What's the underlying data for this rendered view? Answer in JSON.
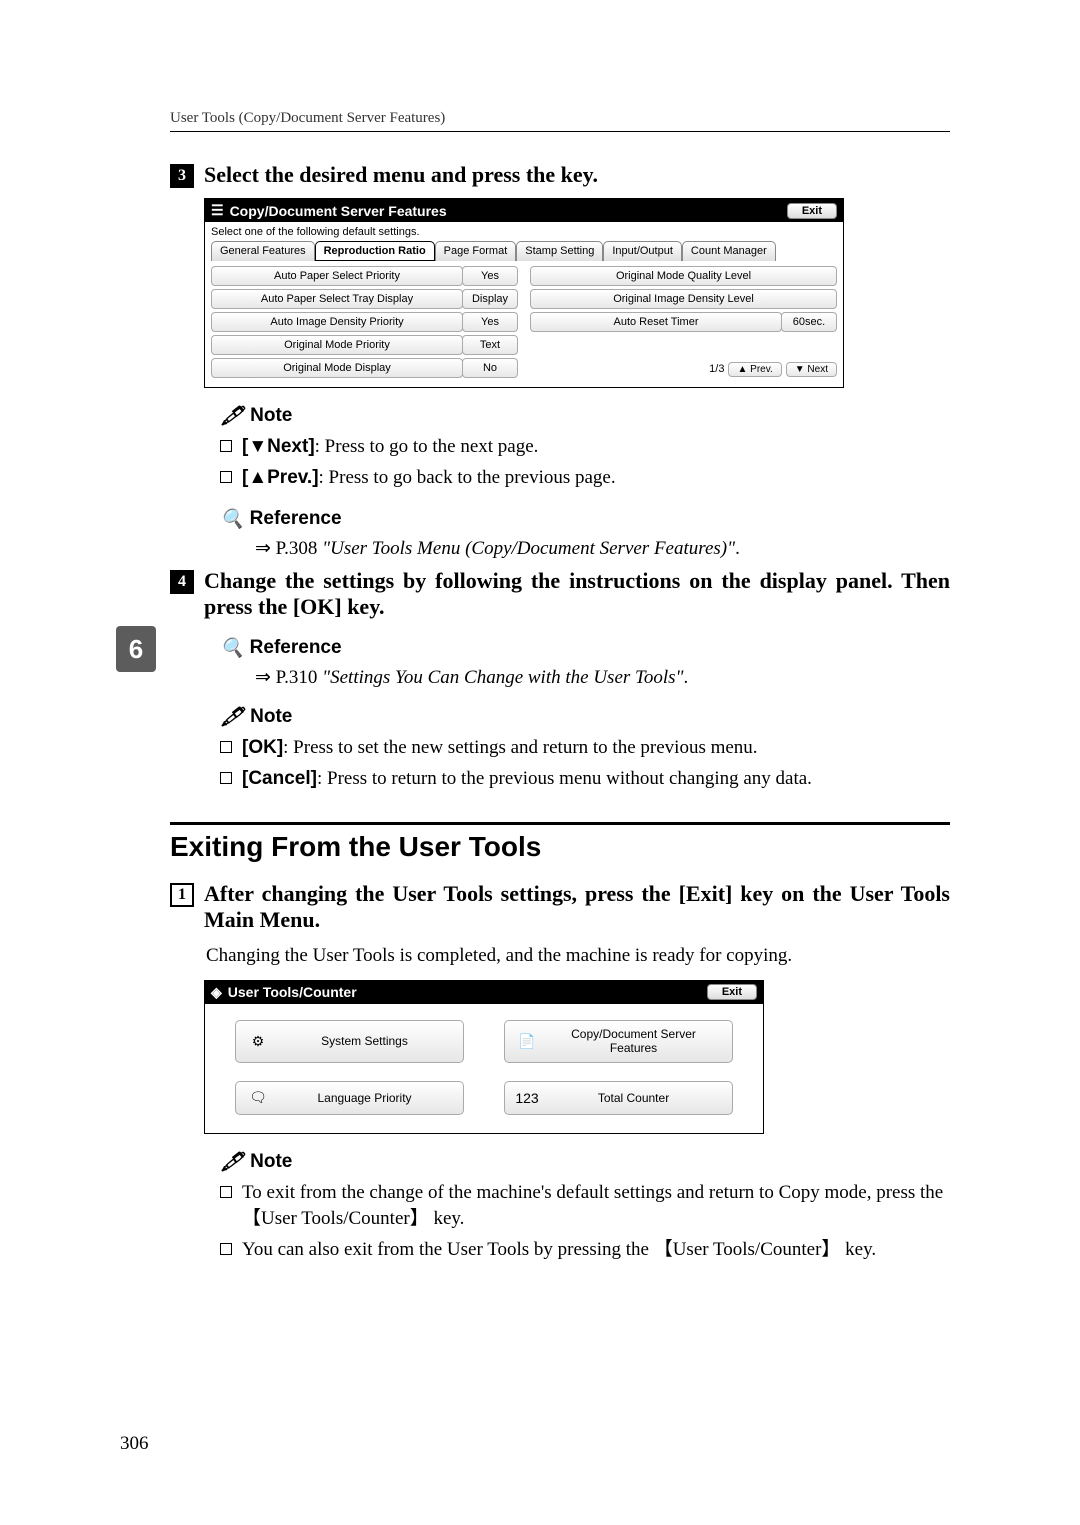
{
  "header": "User Tools (Copy/Document Server Features)",
  "sideTab": "6",
  "pageNumber": "306",
  "step3": {
    "num": "3",
    "text": "Select the desired menu and press the key."
  },
  "panel1": {
    "title": "Copy/Document Server Features",
    "exit": "Exit",
    "instruction": "Select one of the following default settings.",
    "tabs": [
      "General Features",
      "Reproduction Ratio",
      "Page Format",
      "Stamp Setting",
      "Input/Output",
      "Count Manager"
    ],
    "rows": [
      {
        "leftLabel": "Auto Paper Select Priority",
        "leftValue": "Yes",
        "rightLabel": "Original Mode Quality Level",
        "rightValue": ""
      },
      {
        "leftLabel": "Auto Paper Select Tray Display",
        "leftValue": "Display",
        "rightLabel": "Original Image Density Level",
        "rightValue": ""
      },
      {
        "leftLabel": "Auto Image Density Priority",
        "leftValue": "Yes",
        "rightLabel": "Auto Reset Timer",
        "rightValue": "60sec."
      },
      {
        "leftLabel": "Original Mode Priority",
        "leftValue": "Text",
        "rightLabel": "",
        "rightValue": ""
      },
      {
        "leftLabel": "Original Mode Display",
        "leftValue": "No",
        "rightLabel": "",
        "rightValue": ""
      }
    ],
    "pager": {
      "count": "1/3",
      "prev": "▲ Prev.",
      "next": "▼ Next"
    }
  },
  "note1": {
    "head": "Note",
    "items": [
      {
        "label": "[▼Next]",
        "rest": ": Press to go to the next page."
      },
      {
        "label": "[▲Prev.]",
        "rest": ": Press to go back to the previous page."
      }
    ]
  },
  "ref1": {
    "head": "Reference",
    "text": "⇒ P.308 ",
    "italic": "\"User Tools Menu (Copy/Document Server Features)\"",
    "tail": "."
  },
  "step4": {
    "num": "4",
    "text": "Change the settings by following the instructions on the display panel. Then press the [OK] key."
  },
  "ref2": {
    "head": "Reference",
    "text": "⇒ P.310 ",
    "italic": "\"Settings You Can Change with the User Tools\"",
    "tail": "."
  },
  "note2": {
    "head": "Note",
    "items": [
      {
        "label": "[OK]",
        "rest": ": Press to set the new settings and return to the previous menu."
      },
      {
        "label": "[Cancel]",
        "rest": ": Press to return to the previous menu without changing any data."
      }
    ]
  },
  "h2": "Exiting From the User Tools",
  "step1b": {
    "num": "1",
    "text": "After changing the User Tools settings, press the [Exit] key on the User Tools Main Menu."
  },
  "afterStep1b": "Changing the User Tools is completed, and the machine is ready for copying.",
  "panel2": {
    "title": "User Tools/Counter",
    "exit": "Exit",
    "buttons": [
      {
        "icon": "⚙",
        "label": "System Settings"
      },
      {
        "icon": "📄",
        "label": "Copy/Document Server Features"
      },
      {
        "icon": "🗨",
        "label": "Language Priority"
      },
      {
        "icon": "123",
        "label": "Total Counter"
      }
    ]
  },
  "note3": {
    "head": "Note",
    "items": [
      "To exit from the change of the machine's default settings and return to Copy mode, press the 【User Tools/Counter】 key.",
      "You can also exit from the User Tools by pressing the 【User Tools/Counter】 key."
    ]
  }
}
